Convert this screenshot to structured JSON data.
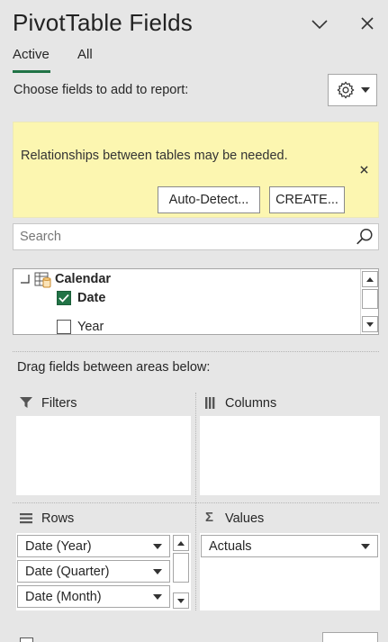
{
  "header": {
    "title": "PivotTable Fields"
  },
  "tabs": [
    {
      "label": "Active"
    },
    {
      "label": "All"
    }
  ],
  "choose_label": "Choose fields to add to report:",
  "notice": {
    "message": "Relationships between tables may be needed.",
    "autodetect_label": "Auto-Detect...",
    "create_label": "CREATE..."
  },
  "search": {
    "placeholder": "Search",
    "value": ""
  },
  "field_tree": {
    "table_name": "Calendar",
    "fields": [
      {
        "label": "Date",
        "checked": true
      },
      {
        "label": "Year",
        "checked": false
      }
    ]
  },
  "drag_label": "Drag fields between areas below:",
  "areas": {
    "filters_label": "Filters",
    "columns_label": "Columns",
    "rows_label": "Rows",
    "values_label": "Values",
    "rows_items": [
      {
        "label": "Date (Year)"
      },
      {
        "label": "Date (Quarter)"
      },
      {
        "label": "Date (Month)"
      }
    ],
    "values_items": [
      {
        "label": "Actuals"
      }
    ]
  },
  "colors": {
    "accent": "#217346",
    "notice_bg": "#fcf6b0"
  },
  "icons": [
    "chevron-down-icon",
    "close-icon",
    "gear-icon",
    "search-icon",
    "table-icon",
    "filter-icon",
    "columns-icon",
    "rows-icon",
    "sigma-icon"
  ]
}
